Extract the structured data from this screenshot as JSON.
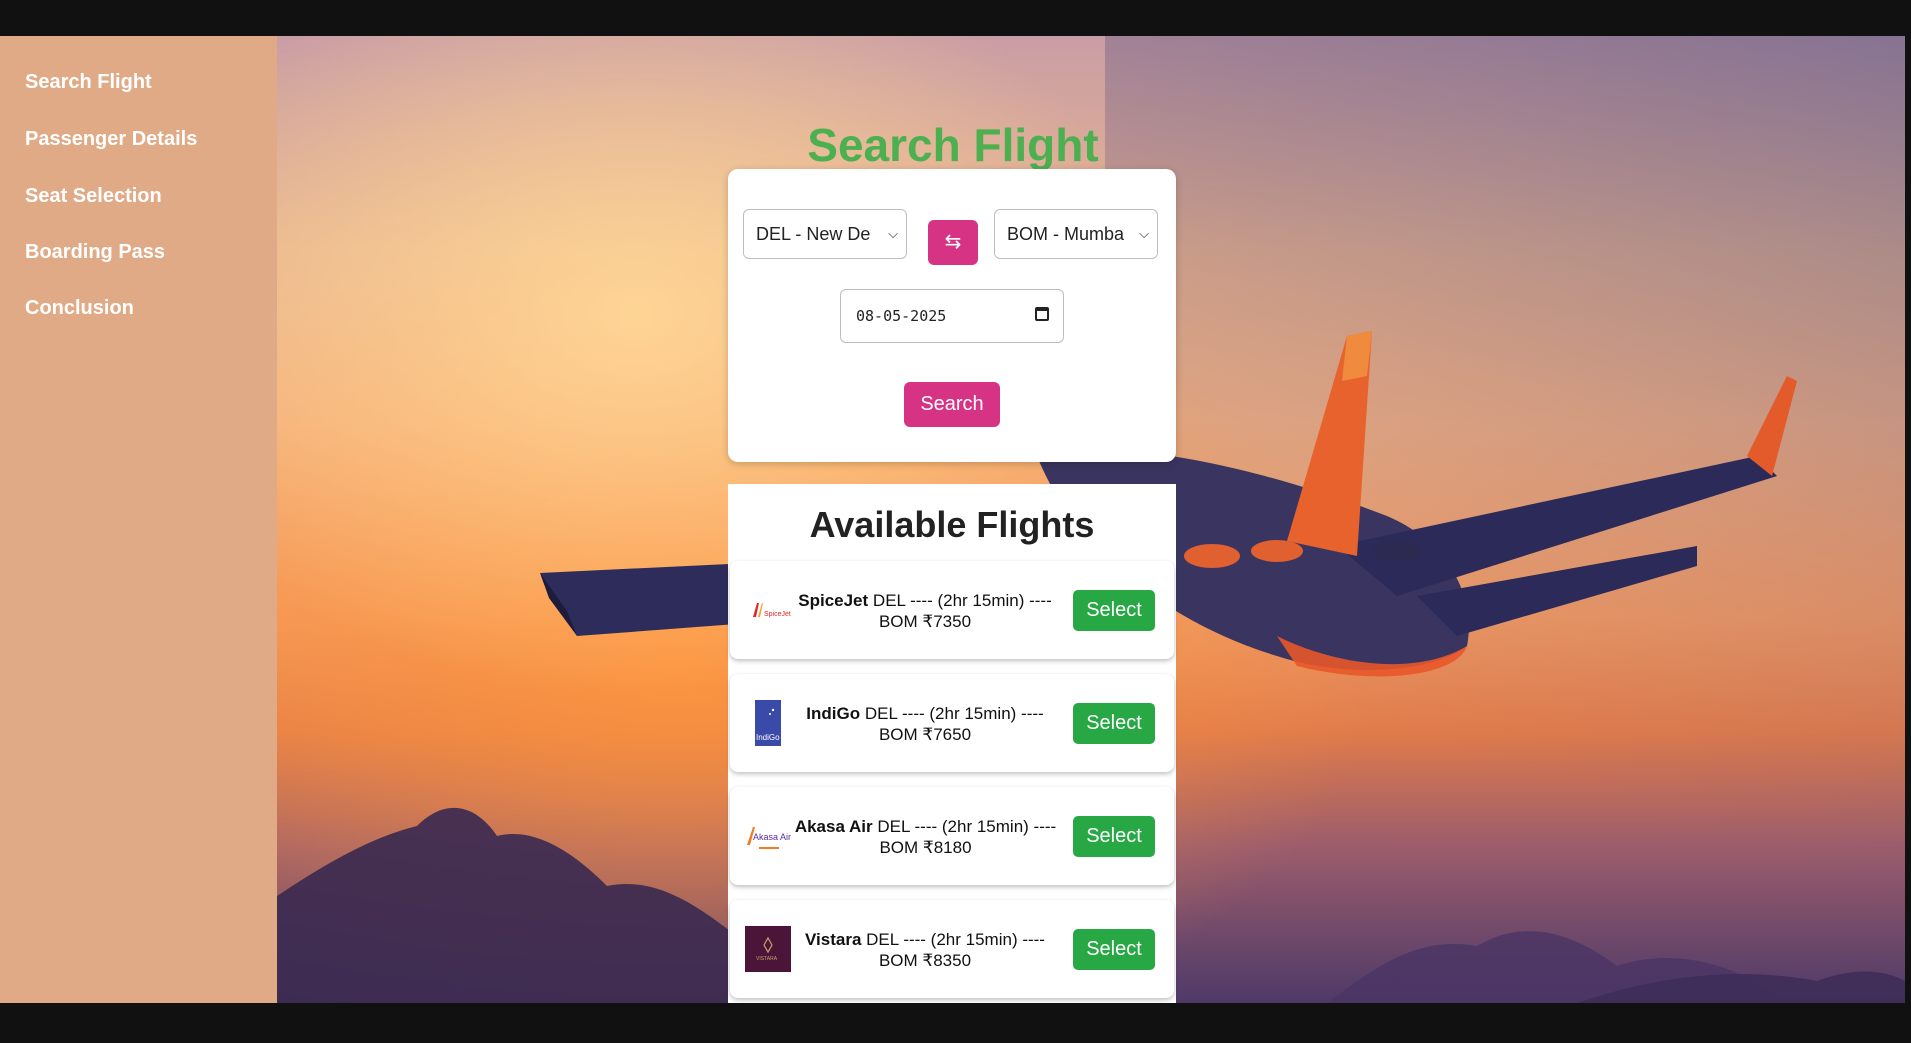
{
  "sidebar": {
    "items": [
      {
        "label": "Search Flight"
      },
      {
        "label": "Passenger Details"
      },
      {
        "label": "Seat Selection"
      },
      {
        "label": "Boarding Pass"
      },
      {
        "label": "Conclusion"
      }
    ]
  },
  "main": {
    "title": "Search Flight",
    "from_select": {
      "value": "DEL - New De"
    },
    "to_select": {
      "value": "BOM - Mumba"
    },
    "swap_icon": "⇆",
    "date_input": {
      "value": "08-05-2025"
    },
    "search_label": "Search",
    "accent_color": "#d63384",
    "title_color": "#4caf50"
  },
  "results": {
    "title": "Available Flights",
    "flights": [
      {
        "airline": "SpiceJet",
        "route": "DEL ---- (2hr 15min) ----",
        "destination": "BOM",
        "price": "₹7350",
        "select_label": "Select",
        "logo_text": "SpiceJet"
      },
      {
        "airline": "IndiGo",
        "route": "DEL ---- (2hr 15min) ----",
        "destination": "BOM",
        "price": "₹7650",
        "select_label": "Select",
        "logo_text": "IndiGo"
      },
      {
        "airline": "Akasa Air",
        "route": "DEL ---- (2hr 15min) ----",
        "destination": "BOM",
        "price": "₹8180",
        "select_label": "Select",
        "logo_text": "Akasa Air"
      },
      {
        "airline": "Vistara",
        "route": "DEL ---- (2hr 15min) ----",
        "destination": "BOM",
        "price": "₹8350",
        "select_label": "Select",
        "logo_text": "VISTARA"
      }
    ],
    "select_color": "#28a745"
  }
}
